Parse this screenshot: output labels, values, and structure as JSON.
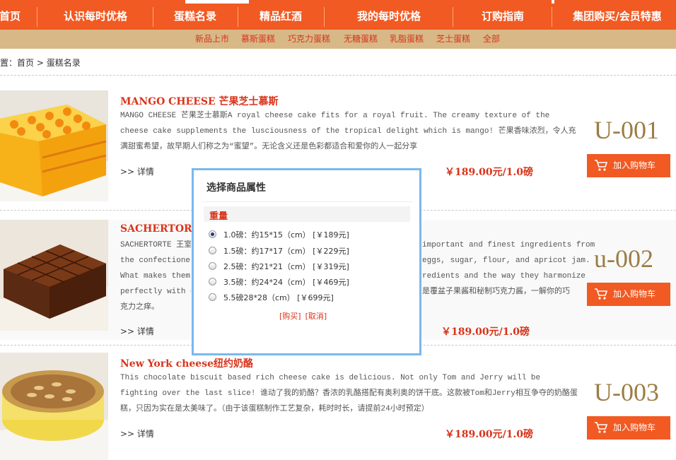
{
  "nav": {
    "items": [
      "首页",
      "认识每时优格",
      "蛋糕名录",
      "精品红酒",
      "我的每时优格",
      "订购指南",
      "集团购买/会员特惠"
    ]
  },
  "subnav": {
    "items": [
      "新品上市",
      "慕斯蛋糕",
      "巧克力蛋糕",
      "无糖蛋糕",
      "乳脂蛋糕",
      "芝士蛋糕",
      "全部"
    ]
  },
  "breadcrumb": {
    "prefix": "位置：",
    "home": "首页",
    "sep": ">",
    "current": "蛋糕名录"
  },
  "products": [
    {
      "title": "MANGO CHEESE 芒果芝士慕斯",
      "desc": "MANGO CHEESE 芒果芝士慕斯A royal cheese cake fits for a royal fruit. The creamy texture of the cheese cake supplements the lusciousness of the tropical delight which is mango! 芒果香味浓烈，令人充满甜蜜希望，故早期人们称之为“蜜望”。无论含义还是色彩都适合和爱你的人一起分享",
      "detail": ">> 详情",
      "price": "￥189.00元/1.0磅",
      "code": "U-001",
      "cart": "加入购物车"
    },
    {
      "title": "SACHERTORTE",
      "desc": "SACHERTORTE 王室沙 ... important and finest ingredients from the confectioner\\ ... eggs, sugar, flour, and apricot jam. What makes them i ... redients and the way they harmonize perfectly with ea ... 是覆盆子果酱和秘制巧克力酱，一解你的巧克力之痒。",
      "desc_lines": [
        {
          "left": "SACHERTORTE 王室沙",
          "right": "important and finest ingredients from"
        },
        {
          "left": "the confectioner\\",
          "right": "eggs, sugar, flour, and apricot jam."
        },
        {
          "left": "What makes them i",
          "right": "redients and the way they harmonize"
        },
        {
          "left": "perfectly with ea",
          "right": "是覆盆子果酱和秘制巧克力酱，一解你的巧"
        },
        {
          "left": "克力之痒。",
          "right": ""
        }
      ],
      "detail": ">> 详情",
      "price": "￥189.00元/1.0磅",
      "code": "u-002",
      "cart": "加入购物车"
    },
    {
      "title": "New York cheese纽约奶酪",
      "desc": "This chocolate biscuit based rich cheese cake is delicious. Not only Tom and Jerry will be fighting over the last slice! 谁动了我的奶酪？香浓的乳酪搭配有奥利奥的饼干底。这款被Tom和Jerry相互争夺的奶酪蛋糕，只因为实在是太美味了。（由于该蛋糕制作工艺复杂，耗时时长，请提前24小时预定）",
      "detail": ">> 详情",
      "price": "￥189.00元/1.0磅",
      "code": "U-003",
      "cart": "加入购物车"
    }
  ],
  "dialog": {
    "title": "选择商品属性",
    "group": "重量",
    "selected_index": 0,
    "options": [
      "1.0磅：约15*15（cm）  [￥189元]",
      "1.5磅：约17*17（cm）  [￥229元]",
      "2.5磅：约21*21（cm）  [￥319元]",
      "3.5磅：约24*24（cm）  [￥469元]",
      "5.5磅28*28（cm）  [￥699元]"
    ],
    "buy": "[购买]",
    "cancel": "[取消]"
  },
  "colors": {
    "nav_bg": "#f15a22",
    "subnav_bg": "#d8b887",
    "accent_red": "#d9331a",
    "code_gold": "#9b7d45",
    "dialog_border": "#7ab8ec"
  }
}
